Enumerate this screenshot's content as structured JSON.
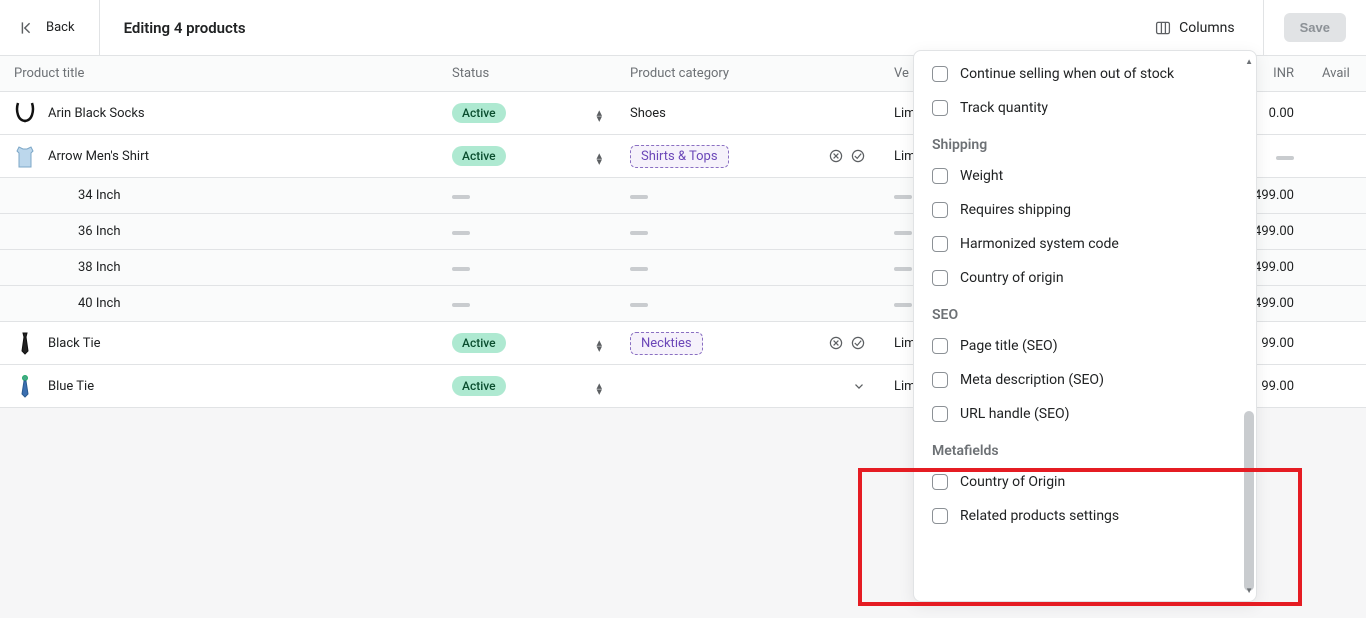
{
  "header": {
    "back_label": "Back",
    "page_title": "Editing 4 products",
    "columns_label": "Columns",
    "save_label": "Save"
  },
  "columns": {
    "product_title": "Product title",
    "status": "Status",
    "product_category": "Product category",
    "vendor_partial": "Ve",
    "inr": "INR",
    "available_partial": "Avail"
  },
  "rows": [
    {
      "type": "product",
      "title": "Arin Black Socks",
      "status": "Active",
      "category_text": "Shoes",
      "category_tag": false,
      "vendor": "Lim",
      "inr": "0.00",
      "show_cat_icons": false,
      "show_chevron": false,
      "thumb": "socks"
    },
    {
      "type": "product",
      "title": "Arrow Men's Shirt",
      "status": "Active",
      "category_text": "Shirts & Tops",
      "category_tag": true,
      "vendor": "Lim",
      "inr": "—",
      "show_cat_icons": true,
      "show_chevron": false,
      "thumb": "shirt"
    },
    {
      "type": "variant",
      "title": "34 Inch",
      "inr": "499.00"
    },
    {
      "type": "variant",
      "title": "36 Inch",
      "inr": "499.00"
    },
    {
      "type": "variant",
      "title": "38 Inch",
      "inr": "499.00"
    },
    {
      "type": "variant",
      "title": "40 Inch",
      "inr": "499.00"
    },
    {
      "type": "product",
      "title": "Black Tie",
      "status": "Active",
      "category_text": "Neckties",
      "category_tag": true,
      "vendor": "Lim",
      "inr": "99.00",
      "show_cat_icons": true,
      "show_chevron": false,
      "thumb": "tie"
    },
    {
      "type": "product",
      "title": "Blue Tie",
      "status": "Active",
      "category_text": "",
      "category_tag": false,
      "vendor": "Lim",
      "inr": "99.00",
      "show_cat_icons": false,
      "show_chevron": true,
      "thumb": "tie-blue"
    }
  ],
  "popover": [
    {
      "type": "item",
      "label": "Continue selling when out of stock"
    },
    {
      "type": "item",
      "label": "Track quantity"
    },
    {
      "type": "heading",
      "label": "Shipping"
    },
    {
      "type": "item",
      "label": "Weight"
    },
    {
      "type": "item",
      "label": "Requires shipping"
    },
    {
      "type": "item",
      "label": "Harmonized system code"
    },
    {
      "type": "item",
      "label": "Country of origin"
    },
    {
      "type": "heading",
      "label": "SEO"
    },
    {
      "type": "item",
      "label": "Page title (SEO)"
    },
    {
      "type": "item",
      "label": "Meta description (SEO)"
    },
    {
      "type": "item",
      "label": "URL handle (SEO)"
    },
    {
      "type": "heading",
      "label": "Metafields"
    },
    {
      "type": "item",
      "label": "Country of Origin"
    },
    {
      "type": "item",
      "label": "Related products settings"
    }
  ]
}
